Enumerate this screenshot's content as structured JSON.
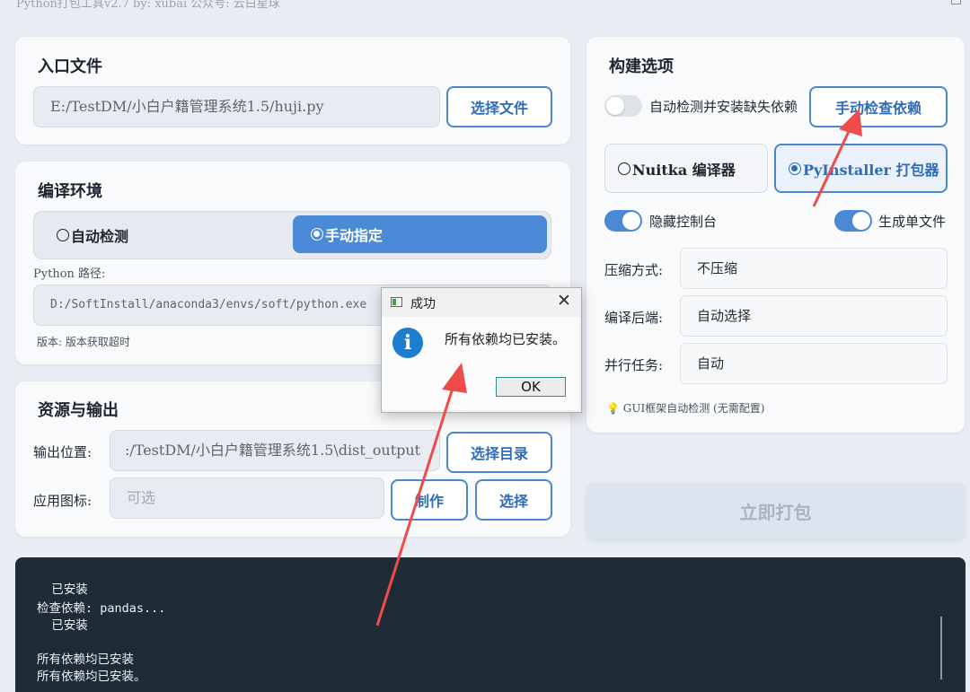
{
  "window": {
    "title": "Python打包工具v2.7 by: xubai 公众号: 云白星球",
    "minimize": "—",
    "maximize": "□"
  },
  "entry": {
    "title": "入口文件",
    "path": "E:/TestDM/小白户籍管理系统1.5/huji.py",
    "select_button": "选择文件"
  },
  "env": {
    "title": "编译环境",
    "auto_label": "自动检测",
    "manual_label": "手动指定",
    "selected": "manual",
    "python_path_label": "Python 路径:",
    "python_path": "D:/SoftInstall/anaconda3/envs/soft/python.exe",
    "version_text": "版本: 版本获取超时"
  },
  "output": {
    "title": "资源与输出",
    "location_label": "输出位置:",
    "location_value": ":/TestDM/小白户籍管理系统1.5\\dist_output",
    "select_dir_button": "选择目录",
    "icon_label": "应用图标:",
    "icon_placeholder": "可选",
    "make_button": "制作",
    "choose_button": "选择"
  },
  "build": {
    "title": "构建选项",
    "auto_deps_label": "自动检测并安装缺失依赖",
    "auto_deps_on": false,
    "check_deps_button": "手动检查依赖",
    "nuitka_label": "Nuitka 编译器",
    "pyinstaller_label": "PyInstaller 打包器",
    "selected_packer": "pyinstaller",
    "hide_console_label": "隐藏控制台",
    "hide_console_on": true,
    "single_file_label": "生成单文件",
    "single_file_on": true,
    "compress_label": "压缩方式:",
    "compress_value": "不压缩",
    "backend_label": "编译后端:",
    "backend_value": "自动选择",
    "jobs_label": "并行任务:",
    "jobs_value": "自动",
    "gui_hint": "GUI框架自动检测 (无需配置)"
  },
  "pack_button": "立即打包",
  "console": {
    "lines": [
      "  已安装",
      "检查依赖: pandas...",
      "  已安装",
      "",
      "所有依赖均已安装",
      "所有依赖均已安装。"
    ]
  },
  "dialog": {
    "title": "成功",
    "message": "所有依赖均已安装。",
    "ok": "OK",
    "close": "✕",
    "info_glyph": "i"
  },
  "colors": {
    "accent": "#4a87cf",
    "annotation_arrow": "#ee4b4b"
  }
}
